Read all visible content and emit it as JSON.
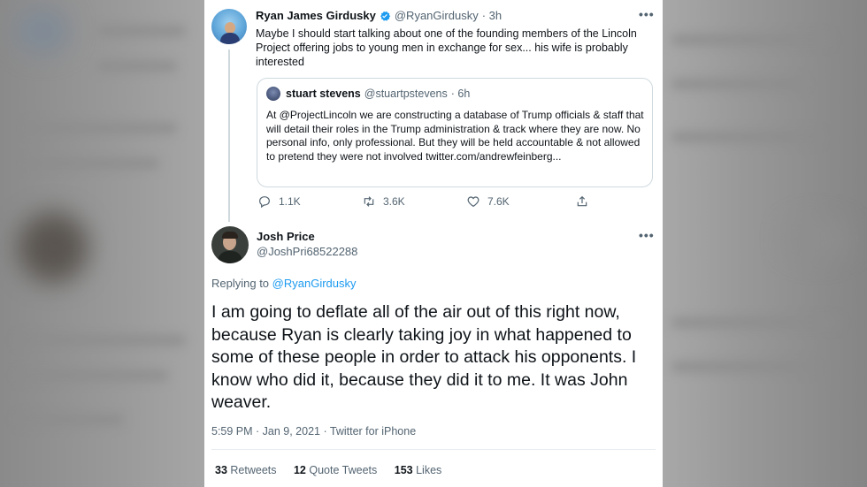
{
  "colors": {
    "accent": "#1d9bf0",
    "text": "#0f1419",
    "muted": "#536471",
    "border": "#cfd9de",
    "background": "#ffffff"
  },
  "tweet1": {
    "author_name": "Ryan James Girdusky",
    "verified_icon": "verified-badge-icon",
    "handle": "@RyanGirdusky",
    "time": "· 3h",
    "more_icon": "more-dots-icon",
    "text": "Maybe I should start talking about one of the founding members of the Lincoln Project offering jobs to young men in exchange for sex... his wife is probably interested",
    "quote": {
      "author_name": "stuart stevens",
      "handle": "@stuartpstevens",
      "time": "· 6h",
      "text": "At @ProjectLincoln we are constructing a database of Trump officials & staff that will detail their roles in the Trump administration & track where they are now. No personal info, only professional. But they will be held accountable & not allowed to pretend they were not involved twitter.com/andrewfeinberg..."
    },
    "actions": {
      "reply_count": "1.1K",
      "retweet_count": "3.6K",
      "like_count": "7.6K"
    }
  },
  "tweet2": {
    "author_name": "Josh Price",
    "handle": "@JoshPri68522288",
    "more_icon": "more-dots-icon",
    "replying_prefix": "Replying to",
    "replying_to": "@RyanGirdusky",
    "text": "I am going to deflate all of the air out of this right now, because Ryan is clearly taking joy in what happened to some of these people in order to attack his opponents. I know who did it, because they did it to me. It was John weaver.",
    "meta": "5:59 PM · Jan 9, 2021 · Twitter for iPhone",
    "stats": {
      "retweets_count": "33",
      "retweets_label": "Retweets",
      "quote_tweets_count": "12",
      "quote_tweets_label": "Quote Tweets",
      "likes_count": "153",
      "likes_label": "Likes"
    }
  }
}
